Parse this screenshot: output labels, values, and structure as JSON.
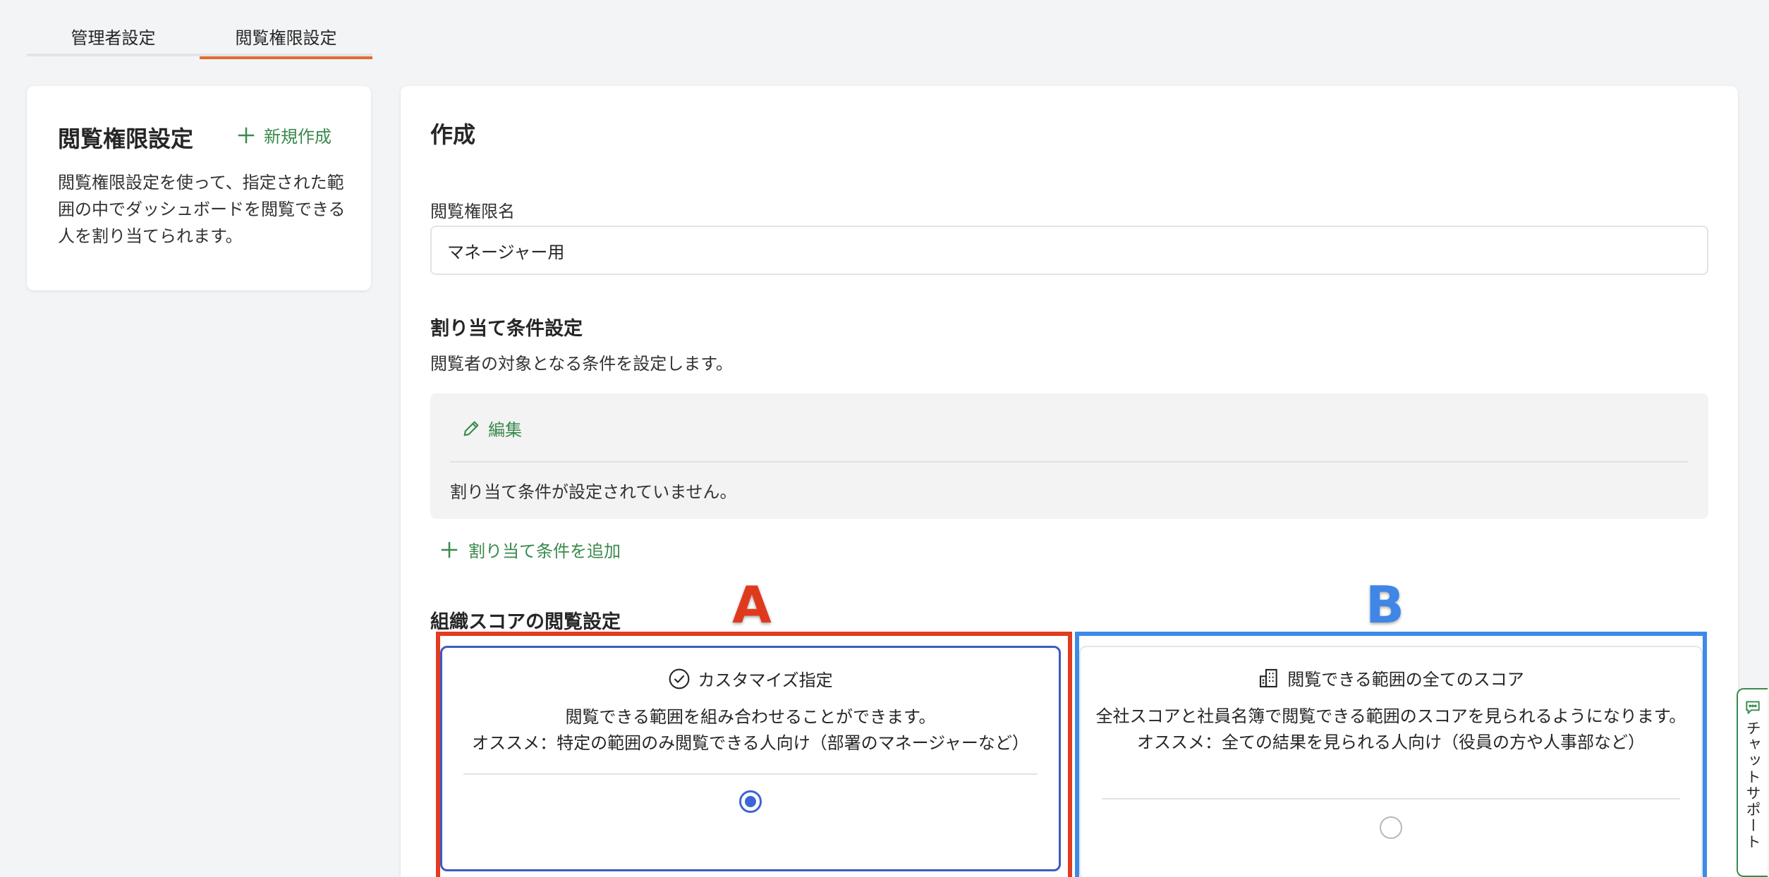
{
  "tabs": [
    {
      "label": "管理者設定",
      "active": false
    },
    {
      "label": "閲覧権限設定",
      "active": true
    }
  ],
  "sidebar": {
    "title": "閲覧権限設定",
    "new_button": "新規作成",
    "description": "閲覧権限設定を使って、指定された範囲の中でダッシュボードを閲覧できる人を割り当てられます。"
  },
  "main": {
    "title": "作成",
    "name_label": "閲覧権限名",
    "name_value": "マネージャー用",
    "assign_title": "割り当て条件設定",
    "assign_desc": "閲覧者の対象となる条件を設定します。",
    "edit_label": "編集",
    "empty_conditions": "割り当て条件が設定されていません。",
    "add_condition": "割り当て条件を追加",
    "score_title": "組織スコアの閲覧設定"
  },
  "options": {
    "a": {
      "title": "カスタマイズ指定",
      "desc1": "閲覧できる範囲を組み合わせることができます。",
      "desc2": "オススメ：特定の範囲のみ閲覧できる人向け（部署のマネージャーなど）",
      "selected": true
    },
    "b": {
      "title": "閲覧できる範囲の全てのスコア",
      "desc1": "全社スコアと社員名簿で閲覧できる範囲のスコアを見られるようになります。",
      "desc2": "オススメ：全ての結果を見られる人向け（役員の方や人事部など）",
      "selected": false
    }
  },
  "annotations": {
    "a": "A",
    "b": "B"
  },
  "chat_support": "チャットサポート",
  "colors": {
    "accent_green": "#3a8a4c",
    "tab_active": "#e36d2b",
    "radio_blue": "#3b66d6",
    "annotation_red": "#e23b1f",
    "annotation_blue": "#3d8ae8"
  }
}
